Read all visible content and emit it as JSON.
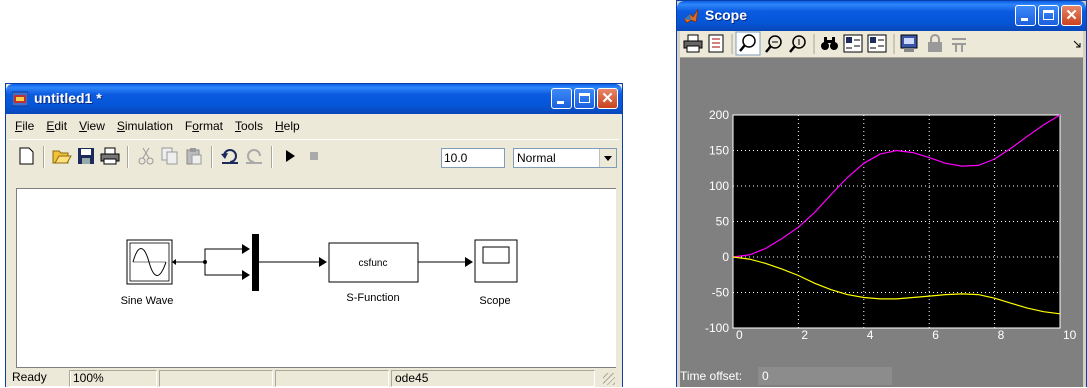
{
  "simulink": {
    "title": "untitled1 *",
    "menu": [
      {
        "ul": "F",
        "rest": "ile"
      },
      {
        "ul": "E",
        "rest": "dit"
      },
      {
        "ul": "V",
        "rest": "iew"
      },
      {
        "ul": "S",
        "rest": "imulation"
      },
      {
        "ul": "",
        "rest": "Format",
        "ul_mid": "o",
        "pre": "F",
        "post": "rmat"
      },
      {
        "ul": "T",
        "rest": "ools"
      },
      {
        "ul": "H",
        "rest": "elp"
      }
    ],
    "toolbar": {
      "stop_time": "10.0",
      "sim_mode": "Normal",
      "icons": [
        "new-icon",
        "open-icon",
        "save-icon",
        "print-icon",
        "cut-icon",
        "copy-icon",
        "paste-icon",
        "undo-icon",
        "redo-icon",
        "play-icon",
        "stop-icon"
      ]
    },
    "blocks": {
      "sine_label": "Sine Wave",
      "sfunc_text": "csfunc",
      "sfunc_label": "S-Function",
      "scope_label": "Scope"
    },
    "status": {
      "ready": "Ready",
      "zoom": "100%",
      "solver": "ode45"
    }
  },
  "scope": {
    "title": "Scope",
    "time_offset_label": "Time offset:",
    "time_offset_value": "0",
    "icons": [
      "print-icon",
      "params-icon",
      "zoom-icon",
      "zoom-x-icon",
      "zoom-y-icon",
      "autoscale-icon",
      "save-axes-icon",
      "restore-axes-icon",
      "float-icon",
      "lock-icon",
      "signal-select-icon"
    ]
  },
  "colors": {
    "series1": "#ff00ff",
    "series2": "#ffff00",
    "plot_bg": "#000000"
  },
  "chart_data": {
    "type": "line",
    "title": "",
    "xlabel": "",
    "ylabel": "",
    "xlim": [
      0,
      10
    ],
    "ylim": [
      -100,
      200
    ],
    "xticks": [
      0,
      2,
      4,
      6,
      8,
      10
    ],
    "yticks": [
      -100,
      -50,
      0,
      50,
      100,
      150,
      200
    ],
    "grid": true,
    "series": [
      {
        "color": "#ff00ff",
        "x": [
          0,
          0.5,
          1,
          1.5,
          2,
          2.5,
          3,
          3.5,
          4,
          4.5,
          5,
          5.5,
          6,
          6.5,
          7,
          7.5,
          8,
          8.5,
          9,
          9.5,
          10
        ],
        "y": [
          0,
          3,
          12,
          26,
          42,
          63,
          88,
          112,
          132,
          145,
          150,
          147,
          140,
          132,
          128,
          129,
          138,
          153,
          170,
          186,
          200
        ]
      },
      {
        "color": "#ffff00",
        "x": [
          0,
          0.5,
          1,
          1.5,
          2,
          2.5,
          3,
          3.5,
          4,
          4.5,
          5,
          5.5,
          6,
          6.5,
          7,
          7.5,
          8,
          8.5,
          9,
          9.5,
          10
        ],
        "y": [
          0,
          -3,
          -9,
          -17,
          -26,
          -37,
          -46,
          -53,
          -57,
          -59,
          -59,
          -57,
          -55,
          -53,
          -52,
          -53,
          -58,
          -65,
          -72,
          -77,
          -80
        ]
      }
    ]
  }
}
